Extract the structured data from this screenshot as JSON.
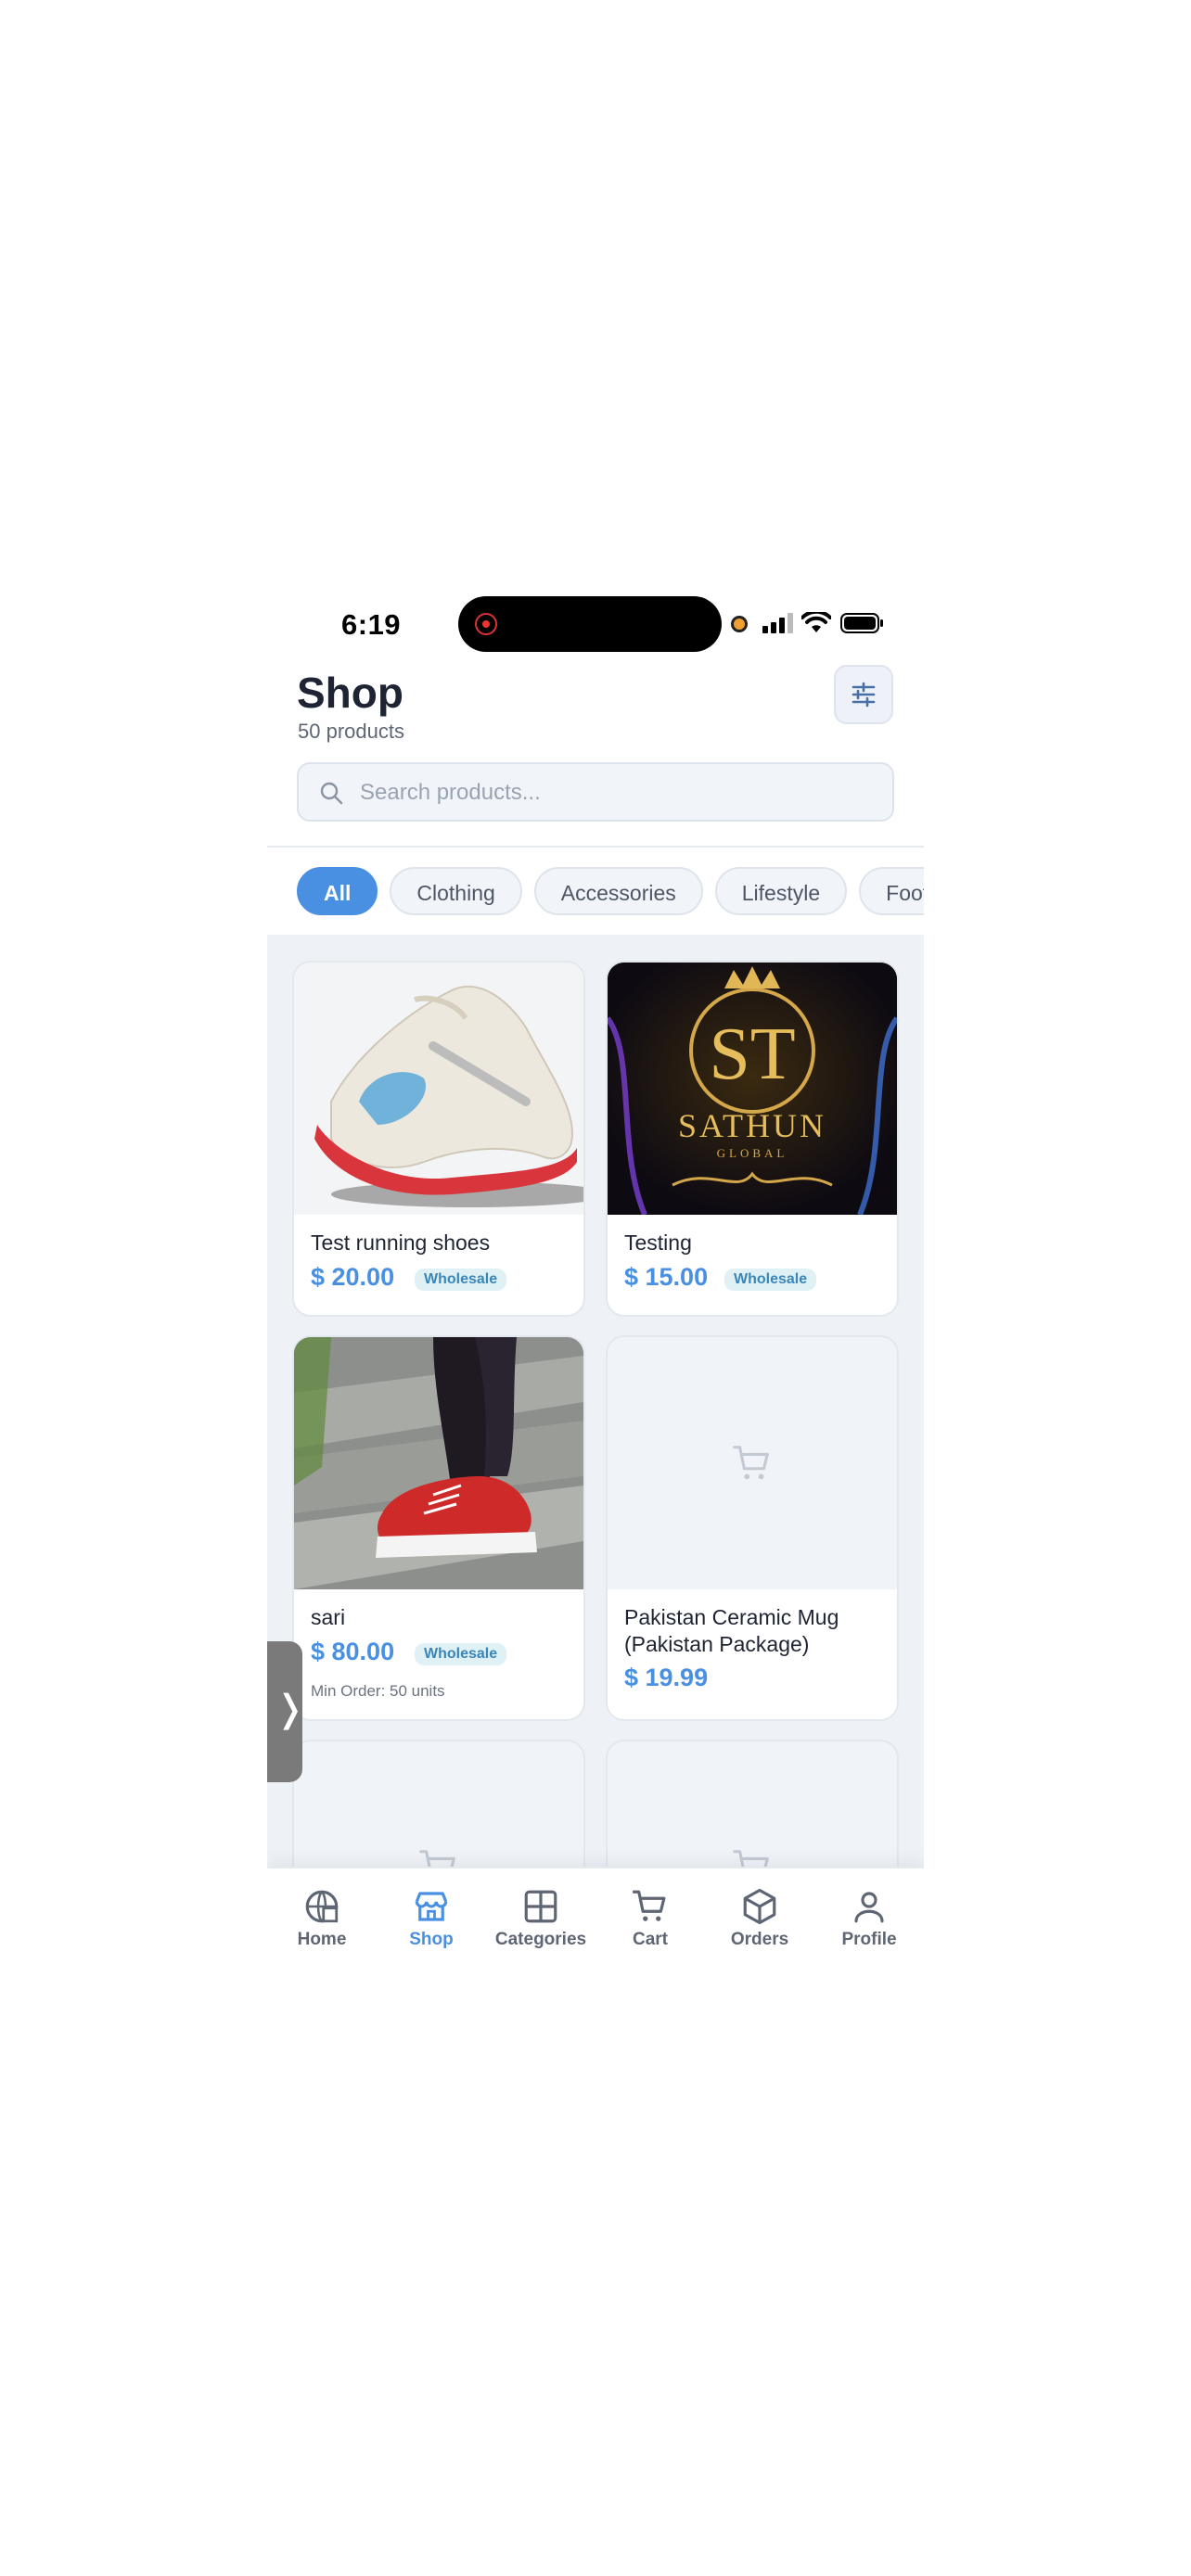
{
  "status_bar": {
    "time": "6:19"
  },
  "header": {
    "title": "Shop",
    "subtitle": "50 products"
  },
  "search": {
    "placeholder": "Search products..."
  },
  "categories": [
    "All",
    "Clothing",
    "Accessories",
    "Lifestyle",
    "Foot"
  ],
  "products": [
    {
      "name": "Test running shoes",
      "price": "$ 20.00",
      "badge": "Wholesale",
      "image": "running-shoe-photo"
    },
    {
      "name": "Testing",
      "price": "$ 15.00",
      "badge": "Wholesale",
      "image": "sathun-global-logo",
      "logo_text": "ST SATHUN GLOBAL"
    },
    {
      "name": "sari",
      "price": "$ 80.00",
      "badge": "Wholesale",
      "min_order": "Min Order: 50 units",
      "image": "red-sneakers-photo"
    },
    {
      "name": "Pakistan Ceramic Mug (Pakistan Package)",
      "price": "$ 19.99",
      "image": "cart-placeholder-icon"
    }
  ],
  "side_tab": {
    "icon": "chevron-right-icon"
  },
  "tabbar": [
    {
      "label": "Home",
      "icon": "home-globe-icon",
      "active": false
    },
    {
      "label": "Shop",
      "icon": "store-icon",
      "active": true
    },
    {
      "label": "Categories",
      "icon": "grid-icon",
      "active": false
    },
    {
      "label": "Cart",
      "icon": "cart-icon",
      "active": false
    },
    {
      "label": "Orders",
      "icon": "box-icon",
      "active": false
    },
    {
      "label": "Profile",
      "icon": "user-icon",
      "active": false
    }
  ],
  "colors": {
    "accent": "#4a90e2",
    "text": "#1e2433",
    "muted": "#5f6776",
    "grid_bg": "#eef2f7"
  }
}
